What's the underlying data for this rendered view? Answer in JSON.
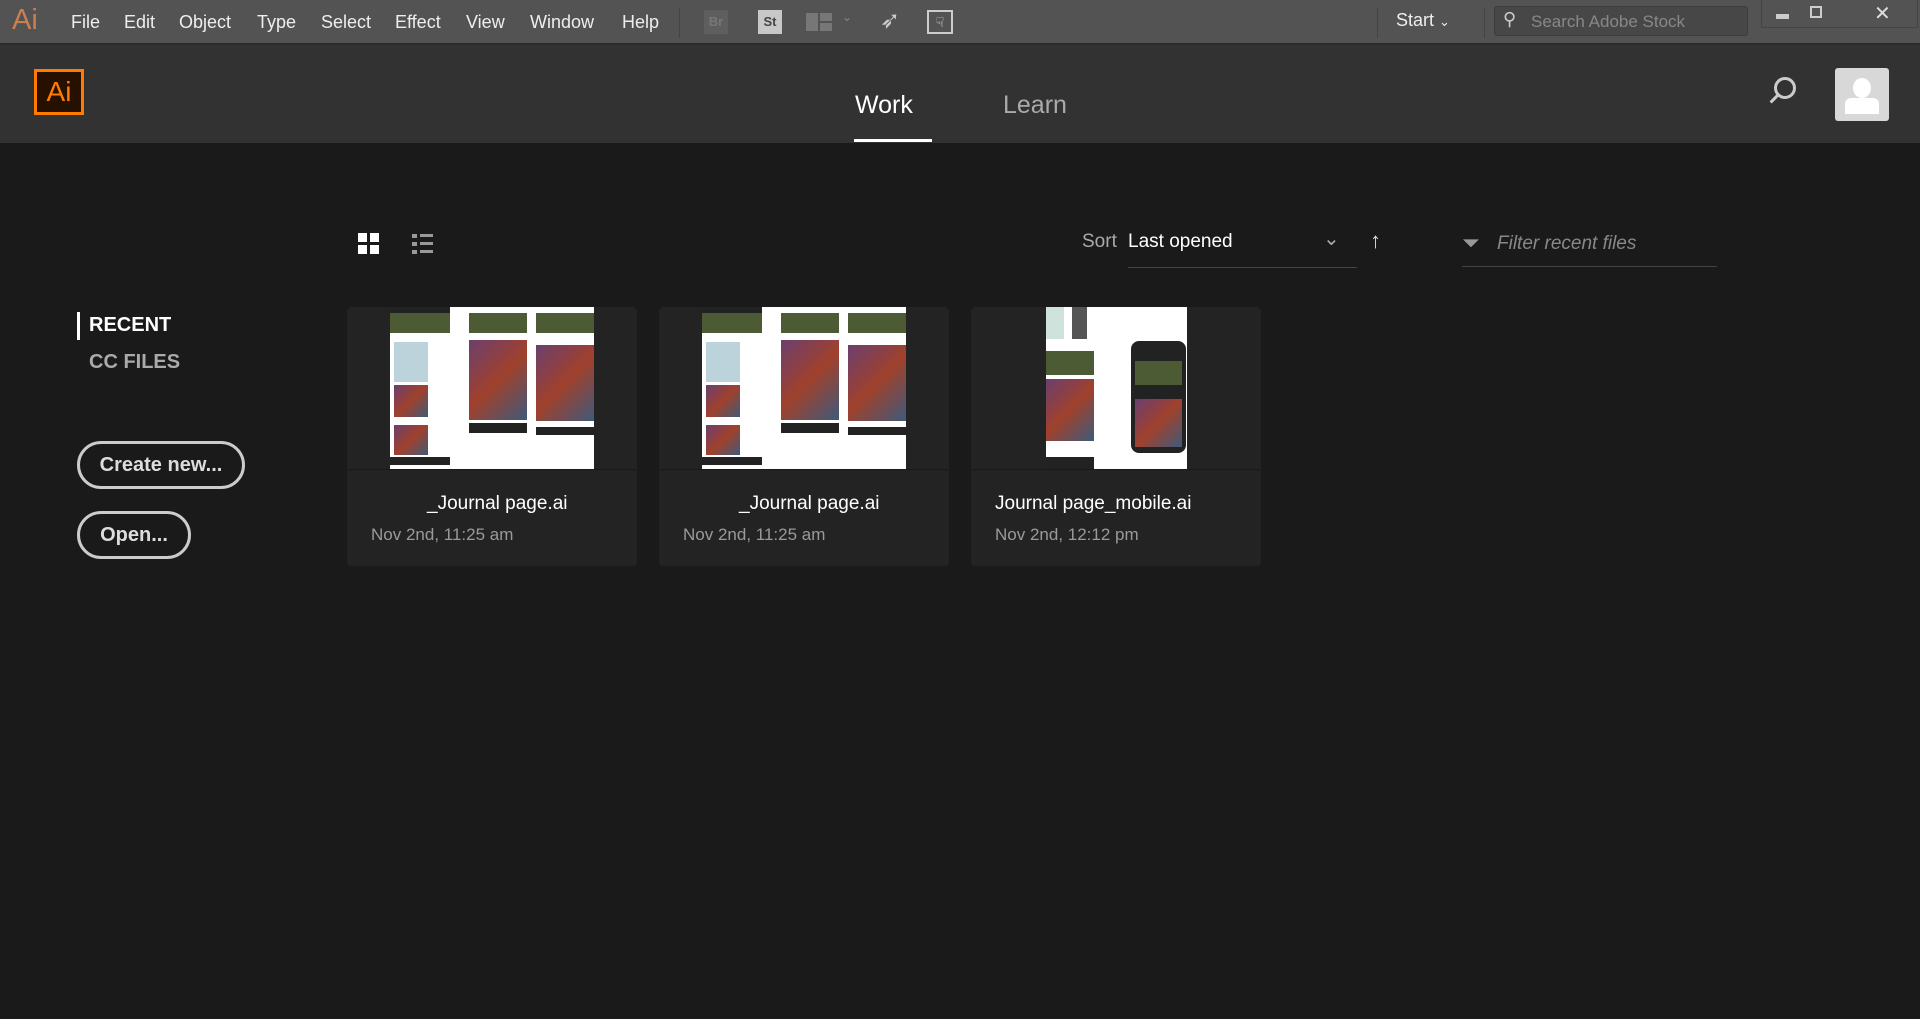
{
  "menubar": {
    "app_icon": "Ai",
    "items": [
      "File",
      "Edit",
      "Object",
      "Type",
      "Select",
      "Effect",
      "View",
      "Window",
      "Help"
    ],
    "bridge_label": "Br",
    "stock_label": "St",
    "workspace": "Start",
    "search_placeholder": "Search Adobe Stock"
  },
  "header": {
    "logo": "Ai",
    "tabs": [
      {
        "label": "Work",
        "active": true
      },
      {
        "label": "Learn",
        "active": false
      }
    ]
  },
  "sidebar": {
    "items": [
      {
        "label": "RECENT",
        "active": true
      },
      {
        "label": "CC FILES",
        "active": false
      }
    ],
    "create_label": "Create new...",
    "open_label": "Open..."
  },
  "toolbar": {
    "view_mode": "grid",
    "sort_label": "Sort",
    "sort_value": "Last opened",
    "sort_direction": "ascending",
    "filter_placeholder": "Filter recent files"
  },
  "files": [
    {
      "name": "_Journal page.ai",
      "date": "Nov 2nd, 11:25 am"
    },
    {
      "name": "_Journal page.ai",
      "date": "Nov 2nd, 11:25 am"
    },
    {
      "name": "Journal page_mobile.ai",
      "date": "Nov 2nd, 12:12 pm"
    }
  ],
  "colors": {
    "accent": "#ff7c00",
    "background": "#1a1a1a",
    "header": "#323232",
    "menubar": "#535353"
  }
}
